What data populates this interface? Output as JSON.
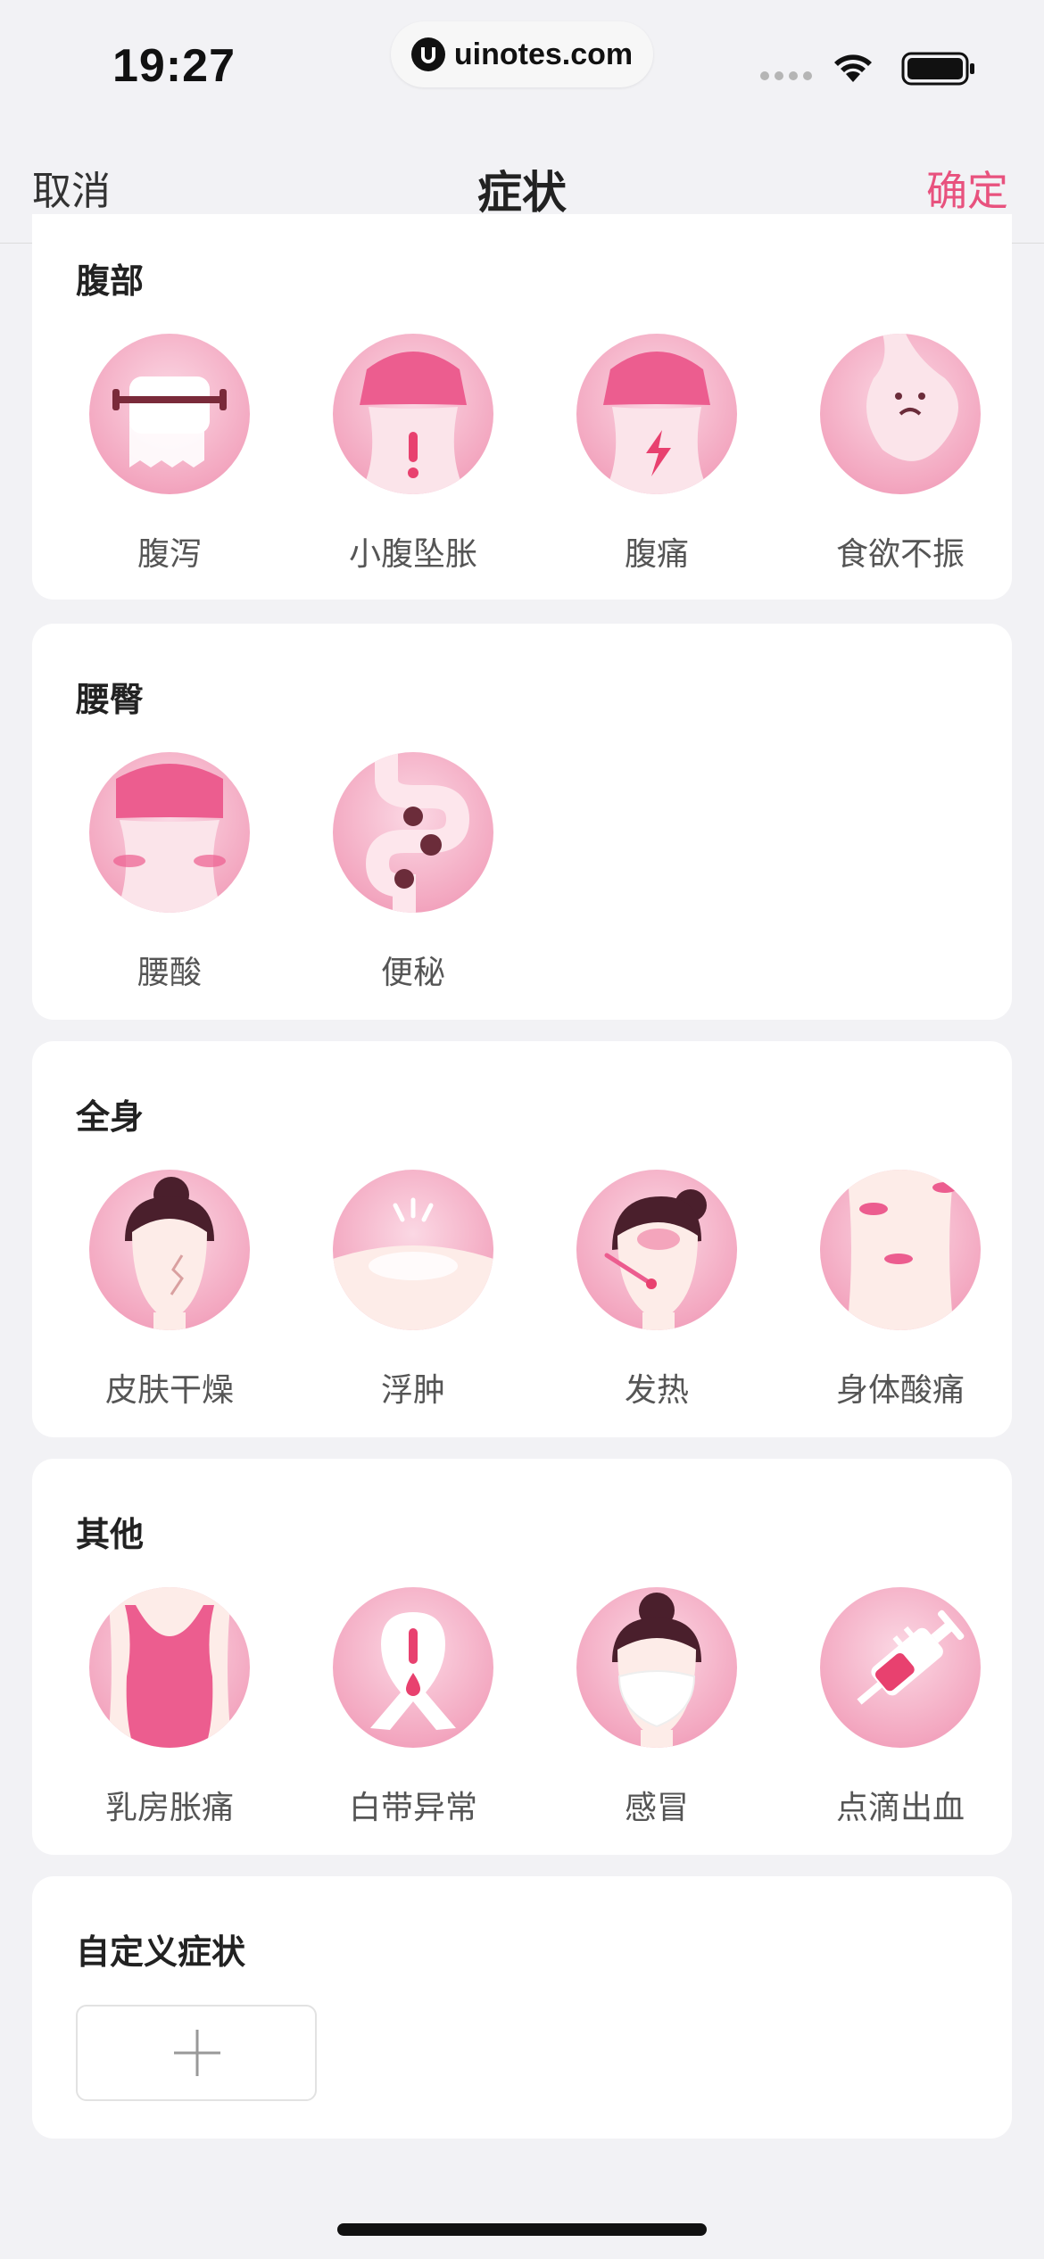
{
  "status_bar": {
    "time": "19:27",
    "url": "uinotes.com"
  },
  "nav": {
    "cancel": "取消",
    "title": "症状",
    "confirm": "确定",
    "accent_color": "#e8527e"
  },
  "sections": {
    "abdomen": {
      "title": "腹部",
      "items": [
        "腹泻",
        "小腹坠胀",
        "腹痛",
        "食欲不振"
      ]
    },
    "waist": {
      "title": "腰臀",
      "items": [
        "腰酸",
        "便秘"
      ]
    },
    "whole_body": {
      "title": "全身",
      "items": [
        "皮肤干燥",
        "浮肿",
        "发热",
        "身体酸痛"
      ]
    },
    "other": {
      "title": "其他",
      "items": [
        "乳房胀痛",
        "白带异常",
        "感冒",
        "点滴出血"
      ]
    },
    "custom": {
      "title": "自定义症状"
    }
  },
  "icons": {
    "abdomen": [
      "toilet-paper-icon",
      "lower-belly-alert-icon",
      "belly-pain-icon",
      "stomach-sad-icon"
    ],
    "waist": [
      "waist-ache-icon",
      "intestine-icon"
    ],
    "whole_body": [
      "dry-skin-face-icon",
      "swelling-icon",
      "fever-thermometer-icon",
      "body-ache-icon"
    ],
    "other": [
      "breast-icon",
      "ribbon-alert-icon",
      "face-mask-icon",
      "syringe-blood-icon"
    ],
    "add": "plus-icon"
  }
}
